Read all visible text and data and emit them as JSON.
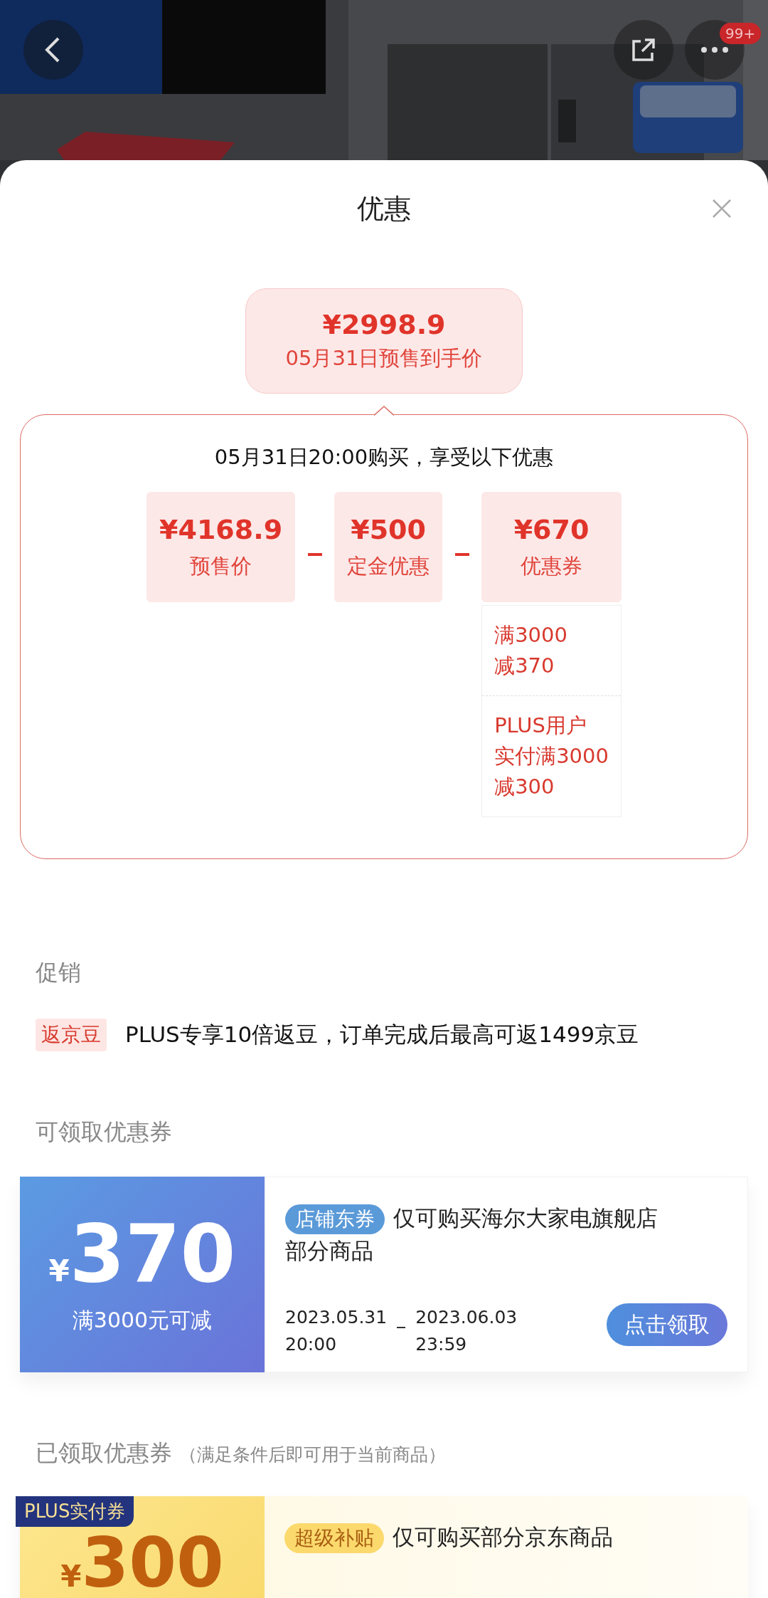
{
  "header": {
    "notification_badge": "99+"
  },
  "sheet": {
    "title": "优惠"
  },
  "final_price": {
    "amount": "¥2998.9",
    "label": "05月31日预售到手价"
  },
  "breakdown": {
    "heading": "05月31日20:00购买，享受以下优惠",
    "items": [
      {
        "amount": "¥4168.9",
        "label": "预售价"
      },
      {
        "amount": "¥500",
        "label": "定金优惠"
      },
      {
        "amount": "¥670",
        "label": "优惠券",
        "details": [
          {
            "lines": [
              "满3000",
              "减370"
            ]
          },
          {
            "lines": [
              "PLUS用户",
              "实付满3000",
              "减300"
            ]
          }
        ]
      }
    ]
  },
  "promotions": {
    "heading": "促销",
    "items": [
      {
        "tag": "返京豆",
        "text": "PLUS专享10倍返豆，订单完成后最高可返1499京豆"
      }
    ]
  },
  "available_coupons": {
    "heading": "可领取优惠券",
    "coupons": [
      {
        "kind": "store",
        "currency": "¥",
        "amount": "370",
        "condition": "满3000元可减",
        "tag": "店铺东券",
        "description_lines": [
          "仅可购买海尔大家电旗舰店",
          "部分商品"
        ],
        "start_date": "2023.05.31",
        "start_time": "20:00",
        "end_date": "2023.06.03",
        "end_time": "23:59",
        "button": "点击领取"
      }
    ]
  },
  "claimed_coupons": {
    "heading": "已领取优惠券",
    "note": "（满足条件后即可用于当前商品）",
    "coupons": [
      {
        "kind": "plus",
        "badge": "PLUS实付券",
        "currency": "¥",
        "amount": "300",
        "tag": "超级补贴",
        "description_lines": [
          "仅可购买部分京东商品"
        ]
      }
    ]
  }
}
